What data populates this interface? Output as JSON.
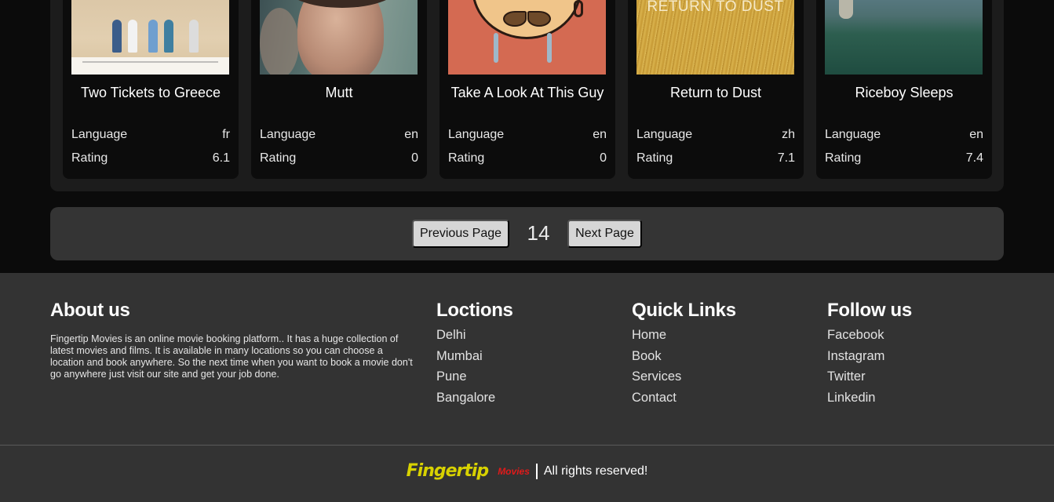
{
  "movies": [
    {
      "title": "Two Tickets to Greece",
      "language": "fr",
      "rating": "6.1"
    },
    {
      "title": "Mutt",
      "language": "en",
      "rating": "0"
    },
    {
      "title": "Take A Look At This Guy",
      "language": "en",
      "rating": "0"
    },
    {
      "title": "Return to Dust",
      "language": "zh",
      "rating": "7.1",
      "poster_text": "RETURN TO DUST"
    },
    {
      "title": "Riceboy Sleeps",
      "language": "en",
      "rating": "7.4"
    }
  ],
  "labels": {
    "language": "Language",
    "rating": "Rating"
  },
  "pagination": {
    "prev_label": "Previous Page",
    "page": "14",
    "next_label": "Next Page"
  },
  "footer": {
    "about": {
      "title": "About us",
      "text": "Fingertip Movies is an online movie booking platform.. It has a huge collection of latest movies and films. It is available in many locations so you can choose a location and book anywhere. So the next time when you want to book a movie don't go anywhere just visit our site and get your job done."
    },
    "locations": {
      "title": "Loctions",
      "items": [
        "Delhi",
        "Mumbai",
        "Pune",
        "Bangalore"
      ]
    },
    "quick_links": {
      "title": "Quick Links",
      "items": [
        "Home",
        "Book",
        "Services",
        "Contact"
      ]
    },
    "follow": {
      "title": "Follow us",
      "items": [
        "Facebook",
        "Instagram",
        "Twitter",
        "Linkedin"
      ]
    },
    "copyright": {
      "brand": "Fingertip",
      "brand_sub": "Movies",
      "rights": "All rights reserved!"
    }
  },
  "colors": {
    "brand_yellow": "#d8d200",
    "brand_red": "#e01a1a",
    "footer_bg": "#333333",
    "button_bg": "#d6d6d6"
  }
}
